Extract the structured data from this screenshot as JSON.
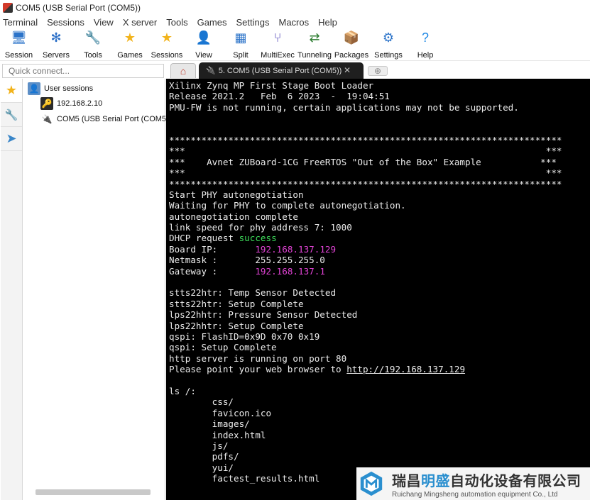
{
  "window": {
    "title": "COM5  (USB Serial Port (COM5))"
  },
  "menu": [
    "Terminal",
    "Sessions",
    "View",
    "X server",
    "Tools",
    "Games",
    "Settings",
    "Macros",
    "Help"
  ],
  "toolbar": [
    {
      "label": "Session",
      "icon": "session-icon",
      "glyph": "🖥",
      "color": "#2b73c9"
    },
    {
      "label": "Servers",
      "icon": "servers-icon",
      "glyph": "✻",
      "color": "#2b6fc7"
    },
    {
      "label": "Tools",
      "icon": "tools-icon",
      "glyph": "🔧",
      "color": "#c0392b"
    },
    {
      "label": "Games",
      "icon": "games-icon",
      "glyph": "★",
      "color": "#f2b31b"
    },
    {
      "label": "Sessions",
      "icon": "sessions-star-icon",
      "glyph": "★",
      "color": "#f2b31b"
    },
    {
      "label": "View",
      "icon": "view-icon",
      "glyph": "👤",
      "color": "#2e7d32"
    },
    {
      "label": "Split",
      "icon": "split-icon",
      "glyph": "▦",
      "color": "#2b73c9"
    },
    {
      "label": "MultiExec",
      "icon": "multiexec-icon",
      "glyph": "⑂",
      "color": "#4a3fb5"
    },
    {
      "label": "Tunneling",
      "icon": "tunneling-icon",
      "glyph": "⇄",
      "color": "#2e7d32"
    },
    {
      "label": "Packages",
      "icon": "packages-icon",
      "glyph": "📦",
      "color": "#6b4a2b"
    },
    {
      "label": "Settings",
      "icon": "settings-icon",
      "glyph": "⚙",
      "color": "#2b73c9"
    },
    {
      "label": "Help",
      "icon": "help-icon",
      "glyph": "?",
      "color": "#1e88e5"
    }
  ],
  "quick_connect": {
    "placeholder": "Quick connect..."
  },
  "tabs": {
    "active_label": "5. COM5  (USB Serial Port (COM5))"
  },
  "sessions": {
    "root": "User sessions",
    "items": [
      "192.168.2.10",
      "COM5  (USB Serial Port (COM5))"
    ]
  },
  "terminal": {
    "lines": [
      [
        {
          "t": "Xilinx Zynq MP First Stage Boot Loader"
        }
      ],
      [
        {
          "t": "Release 2021.2   Feb  6 2023  -  19:04:51"
        }
      ],
      [
        {
          "t": "PMU-FW is not running, certain applications may not be supported."
        }
      ],
      [
        {
          "t": ""
        }
      ],
      [
        {
          "t": ""
        }
      ],
      [
        {
          "t": "*************************************************************************"
        }
      ],
      [
        {
          "t": "***                                                                   ***"
        }
      ],
      [
        {
          "t": "***    Avnet ZUBoard-1CG FreeRTOS \"Out of the Box\" Example           ***"
        }
      ],
      [
        {
          "t": "***                                                                   ***"
        }
      ],
      [
        {
          "t": "*************************************************************************"
        }
      ],
      [
        {
          "t": "Start PHY autonegotiation"
        }
      ],
      [
        {
          "t": "Waiting for PHY to complete autonegotiation."
        }
      ],
      [
        {
          "t": "autonegotiation complete"
        }
      ],
      [
        {
          "t": "link speed for phy address 7: 1000"
        }
      ],
      [
        {
          "t": "DHCP request "
        },
        {
          "t": "success",
          "c": "grn"
        }
      ],
      [
        {
          "t": "Board IP:       "
        },
        {
          "t": "192.168.137.129",
          "c": "mag"
        }
      ],
      [
        {
          "t": "Netmask :       255.255.255.0"
        }
      ],
      [
        {
          "t": "Gateway :       "
        },
        {
          "t": "192.168.137.1",
          "c": "mag"
        }
      ],
      [
        {
          "t": ""
        }
      ],
      [
        {
          "t": "stts22htr: Temp Sensor Detected"
        }
      ],
      [
        {
          "t": "stts22htr: Setup Complete"
        }
      ],
      [
        {
          "t": "lps22hhtr: Pressure Sensor Detected"
        }
      ],
      [
        {
          "t": "lps22hhtr: Setup Complete"
        }
      ],
      [
        {
          "t": "qspi: FlashID=0x9D 0x70 0x19"
        }
      ],
      [
        {
          "t": "qspi: Setup Complete"
        }
      ],
      [
        {
          "t": "http server is running on port 80"
        }
      ],
      [
        {
          "t": "Please point your web browser to "
        },
        {
          "t": "http://192.168.137.129",
          "c": "link"
        }
      ],
      [
        {
          "t": ""
        }
      ],
      [
        {
          "t": "ls /:"
        }
      ],
      [
        {
          "t": "        css/"
        }
      ],
      [
        {
          "t": "        favicon.ico"
        }
      ],
      [
        {
          "t": "        images/"
        }
      ],
      [
        {
          "t": "        index.html"
        }
      ],
      [
        {
          "t": "        js/"
        }
      ],
      [
        {
          "t": "        pdfs/"
        }
      ],
      [
        {
          "t": "        yui/"
        }
      ],
      [
        {
          "t": "        factest_results.html"
        }
      ]
    ]
  },
  "watermark": {
    "cn_prefix": "瑞昌",
    "cn_highlight": "明盛",
    "cn_suffix": "自动化设备有限公司",
    "en": "Ruichang Mingsheng automation equipment Co., Ltd"
  }
}
